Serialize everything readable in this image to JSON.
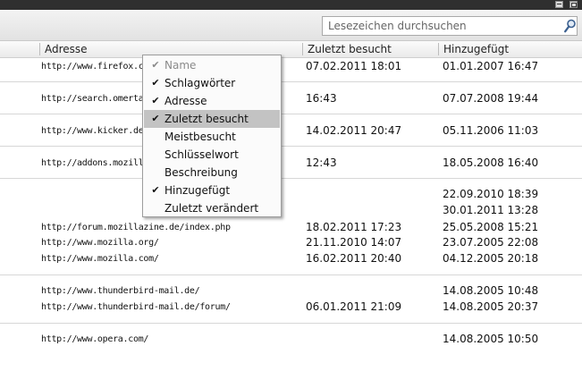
{
  "search": {
    "placeholder": "Lesezeichen durchsuchen"
  },
  "columns": {
    "address": "Adresse",
    "last_visited": "Zuletzt besucht",
    "added": "Hinzugefügt"
  },
  "menu": {
    "items": [
      {
        "label": "Name",
        "checked": true,
        "disabled": true
      },
      {
        "label": "Schlagwörter",
        "checked": true
      },
      {
        "label": "Adresse",
        "checked": true
      },
      {
        "label": "Zuletzt besucht",
        "checked": true,
        "highlighted": true
      },
      {
        "label": "Meistbesucht",
        "checked": false
      },
      {
        "label": "Schlüsselwort",
        "checked": false
      },
      {
        "label": "Beschreibung",
        "checked": false
      },
      {
        "label": "Hinzugefügt",
        "checked": true
      },
      {
        "label": "Zuletzt verändert",
        "checked": false
      }
    ]
  },
  "rows": [
    {
      "url": "http://www.firefox.com/",
      "last_visited": "07.02.2011 18:01",
      "added": "01.01.2007 16:47"
    },
    {
      "url": "http://search.omerta/",
      "last_visited": "16:43",
      "added": "07.07.2008 19:44"
    },
    {
      "url": "http://www.kicker.de/",
      "last_visited": "14.02.2011 20:47",
      "added": "05.11.2006 11:03"
    },
    {
      "url": "http://addons.mozilla.org/",
      "last_visited": "12:43",
      "added": "18.05.2008 16:40"
    },
    {
      "url": "",
      "last_visited": "",
      "added": "22.09.2010 18:39"
    },
    {
      "url": "",
      "last_visited": "",
      "added": "30.01.2011 13:28"
    },
    {
      "url": "http://forum.mozillazine.de/index.php",
      "last_visited": "18.02.2011 17:23",
      "added": "25.05.2008 15:21"
    },
    {
      "url": "http://www.mozilla.org/",
      "last_visited": "21.11.2010 14:07",
      "added": "23.07.2005 22:08"
    },
    {
      "url": "http://www.mozilla.com/",
      "last_visited": "16.02.2011 20:40",
      "added": "04.12.2005 20:18"
    },
    {
      "url": "http://www.thunderbird-mail.de/",
      "last_visited": "",
      "added": "14.08.2005 10:48"
    },
    {
      "url": "http://www.thunderbird-mail.de/forum/",
      "last_visited": "06.01.2011 21:09",
      "added": "14.08.2005 20:37"
    },
    {
      "url": "http://www.opera.com/",
      "last_visited": "",
      "added": "14.08.2005 10:50"
    }
  ]
}
